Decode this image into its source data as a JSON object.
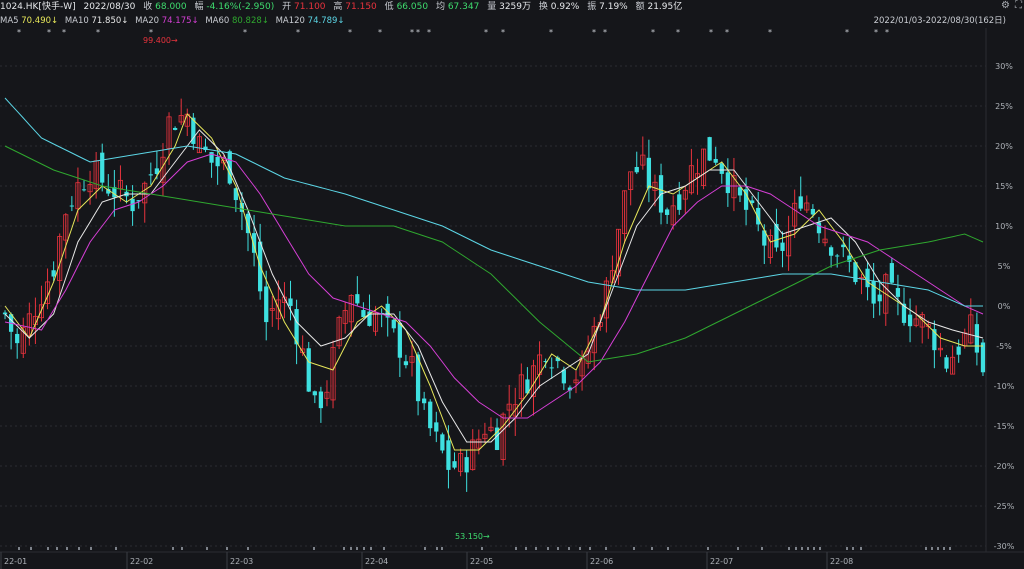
{
  "header": {
    "code": "1024.HK[快手-W]",
    "date": "2022/08/30",
    "close_label": "收",
    "close_value": "68.000",
    "change_label": "幅",
    "change_value": "-4.16%(-2.950)",
    "open_label": "开",
    "open_value": "71.100",
    "high_label": "高",
    "high_value": "71.150",
    "low_label": "低",
    "low_value": "66.050",
    "avg_label": "均",
    "avg_value": "67.347",
    "volume_label": "量",
    "volume_value": "3259万",
    "turnover_label": "换",
    "turnover_value": "0.92%",
    "amplitude_label": "振",
    "amplitude_value": "7.19%",
    "amount_label": "额",
    "amount_value": "21.95亿"
  },
  "ma_bar": {
    "ma5_label": "MA5",
    "ma5_value": "70.490↓",
    "ma10_label": "MA10",
    "ma10_value": "71.850↓",
    "ma20_label": "MA20",
    "ma20_value": "74.175↓",
    "ma60_label": "MA60",
    "ma60_value": "80.828↓",
    "ma120_label": "MA120",
    "ma120_value": "74.789↓"
  },
  "date_range": "2022/01/03-2022/08/30(162日)",
  "colors": {
    "up": "#e8333d",
    "down": "#3ee0e0",
    "ma5": "#e7e75a",
    "ma10": "#e8e8e8",
    "ma20": "#d63fd6",
    "ma60": "#2fa72f",
    "ma120": "#5cd6e6",
    "background": "#15161a"
  },
  "chart_data": {
    "type": "candlestick",
    "axis": {
      "x_tick_labels": [
        "22-01",
        "22-02",
        "22-03",
        "22-04",
        "22-05",
        "22-06",
        "22-07",
        "22-08"
      ],
      "y_tick_labels": [
        "30%",
        "25%",
        "20%",
        "15%",
        "10%",
        "5%",
        "0%",
        "-5%",
        "-10%",
        "-15%",
        "-20%",
        "-25%",
        "-30%"
      ],
      "y_pct_range": [
        -30,
        30
      ]
    },
    "base_price": 70.95,
    "annotations": {
      "high_label": "99.400",
      "low_label": "53.150"
    },
    "price_path_pct": [
      [
        0,
        -1
      ],
      [
        2,
        -5
      ],
      [
        5,
        0
      ],
      [
        8,
        5
      ],
      [
        10,
        12
      ],
      [
        12,
        15
      ],
      [
        14,
        17
      ],
      [
        17,
        15
      ],
      [
        19,
        14
      ],
      [
        21,
        13
      ],
      [
        23,
        15
      ],
      [
        25,
        18
      ],
      [
        27,
        23
      ],
      [
        30,
        24
      ],
      [
        32,
        20
      ],
      [
        34,
        18
      ],
      [
        37,
        17
      ],
      [
        39,
        12
      ],
      [
        41,
        6
      ],
      [
        43,
        -2
      ],
      [
        45,
        1
      ],
      [
        47,
        0
      ],
      [
        49,
        -6
      ],
      [
        51,
        -13
      ],
      [
        53,
        -10
      ],
      [
        55,
        -3
      ],
      [
        57,
        2
      ],
      [
        59,
        -1
      ],
      [
        61,
        -1
      ],
      [
        63,
        -3
      ],
      [
        65,
        -5
      ],
      [
        67,
        -8
      ],
      [
        69,
        -14
      ],
      [
        71,
        -17
      ],
      [
        73,
        -20
      ],
      [
        75,
        -20
      ],
      [
        77,
        -18
      ],
      [
        79,
        -15
      ],
      [
        81,
        -16
      ],
      [
        83,
        -12
      ],
      [
        85,
        -10
      ],
      [
        87,
        -8
      ],
      [
        89,
        -5
      ],
      [
        91,
        -7
      ],
      [
        93,
        -9
      ],
      [
        95,
        -8
      ],
      [
        97,
        -3
      ],
      [
        99,
        2
      ],
      [
        101,
        10
      ],
      [
        103,
        17
      ],
      [
        105,
        17
      ],
      [
        107,
        14
      ],
      [
        109,
        12
      ],
      [
        111,
        14
      ],
      [
        113,
        17
      ],
      [
        115,
        19
      ],
      [
        117,
        19
      ],
      [
        119,
        16
      ],
      [
        121,
        13
      ],
      [
        123,
        11
      ],
      [
        125,
        8
      ],
      [
        127,
        6
      ],
      [
        129,
        9
      ],
      [
        131,
        14
      ],
      [
        133,
        12
      ],
      [
        135,
        9
      ],
      [
        137,
        7
      ],
      [
        139,
        5
      ],
      [
        141,
        3
      ],
      [
        143,
        0
      ],
      [
        145,
        2
      ],
      [
        147,
        0
      ],
      [
        149,
        -1
      ],
      [
        151,
        -2
      ],
      [
        153,
        -4
      ],
      [
        155,
        -7
      ],
      [
        157,
        -5
      ],
      [
        159,
        -3
      ],
      [
        161,
        -8
      ]
    ],
    "ma_paths_pct": {
      "MA5": [
        [
          0,
          0
        ],
        [
          4,
          -4
        ],
        [
          8,
          3
        ],
        [
          12,
          12
        ],
        [
          16,
          15
        ],
        [
          20,
          13
        ],
        [
          24,
          15
        ],
        [
          28,
          20
        ],
        [
          30,
          24
        ],
        [
          34,
          21
        ],
        [
          38,
          15
        ],
        [
          42,
          5
        ],
        [
          46,
          -2
        ],
        [
          50,
          -7
        ],
        [
          54,
          -8
        ],
        [
          58,
          -2
        ],
        [
          62,
          0
        ],
        [
          66,
          -3
        ],
        [
          70,
          -10
        ],
        [
          74,
          -18
        ],
        [
          78,
          -18
        ],
        [
          82,
          -15
        ],
        [
          86,
          -11
        ],
        [
          90,
          -6
        ],
        [
          94,
          -8
        ],
        [
          98,
          -2
        ],
        [
          102,
          8
        ],
        [
          106,
          15
        ],
        [
          110,
          14
        ],
        [
          114,
          16
        ],
        [
          118,
          18
        ],
        [
          122,
          14
        ],
        [
          126,
          8
        ],
        [
          130,
          9
        ],
        [
          134,
          12
        ],
        [
          138,
          8
        ],
        [
          142,
          3
        ],
        [
          146,
          1
        ],
        [
          150,
          -1
        ],
        [
          154,
          -4
        ],
        [
          158,
          -5
        ],
        [
          161,
          -5
        ]
      ],
      "MA10": [
        [
          0,
          -1
        ],
        [
          4,
          -4
        ],
        [
          8,
          -1
        ],
        [
          12,
          8
        ],
        [
          16,
          13
        ],
        [
          20,
          14
        ],
        [
          24,
          14
        ],
        [
          28,
          18
        ],
        [
          32,
          22
        ],
        [
          36,
          19
        ],
        [
          40,
          12
        ],
        [
          44,
          4
        ],
        [
          48,
          -2
        ],
        [
          52,
          -5
        ],
        [
          56,
          -4
        ],
        [
          60,
          -1
        ],
        [
          64,
          -1
        ],
        [
          68,
          -5
        ],
        [
          72,
          -12
        ],
        [
          76,
          -17
        ],
        [
          80,
          -17
        ],
        [
          84,
          -14
        ],
        [
          88,
          -10
        ],
        [
          92,
          -8
        ],
        [
          96,
          -6
        ],
        [
          100,
          2
        ],
        [
          104,
          10
        ],
        [
          108,
          14
        ],
        [
          112,
          15
        ],
        [
          116,
          17
        ],
        [
          120,
          17
        ],
        [
          124,
          13
        ],
        [
          128,
          9
        ],
        [
          132,
          10
        ],
        [
          136,
          11
        ],
        [
          140,
          8
        ],
        [
          144,
          3
        ],
        [
          148,
          0
        ],
        [
          152,
          -2
        ],
        [
          156,
          -3
        ],
        [
          161,
          -4
        ]
      ],
      "MA20": [
        [
          0,
          -2
        ],
        [
          6,
          -3
        ],
        [
          10,
          2
        ],
        [
          14,
          8
        ],
        [
          18,
          12
        ],
        [
          22,
          13
        ],
        [
          26,
          15
        ],
        [
          30,
          18
        ],
        [
          34,
          19
        ],
        [
          38,
          18
        ],
        [
          42,
          14
        ],
        [
          46,
          9
        ],
        [
          50,
          4
        ],
        [
          54,
          1
        ],
        [
          58,
          0
        ],
        [
          62,
          -1
        ],
        [
          66,
          -2
        ],
        [
          70,
          -5
        ],
        [
          74,
          -9
        ],
        [
          78,
          -12
        ],
        [
          82,
          -14
        ],
        [
          86,
          -14
        ],
        [
          90,
          -12
        ],
        [
          94,
          -10
        ],
        [
          98,
          -7
        ],
        [
          102,
          -2
        ],
        [
          106,
          4
        ],
        [
          110,
          10
        ],
        [
          114,
          13
        ],
        [
          118,
          15
        ],
        [
          122,
          15
        ],
        [
          126,
          14
        ],
        [
          130,
          12
        ],
        [
          134,
          10
        ],
        [
          138,
          9
        ],
        [
          142,
          8
        ],
        [
          146,
          6
        ],
        [
          150,
          4
        ],
        [
          154,
          2
        ],
        [
          158,
          0
        ],
        [
          161,
          -1
        ]
      ],
      "MA60": [
        [
          0,
          20
        ],
        [
          8,
          17
        ],
        [
          16,
          15
        ],
        [
          24,
          14
        ],
        [
          32,
          13
        ],
        [
          40,
          12
        ],
        [
          48,
          11
        ],
        [
          56,
          10
        ],
        [
          64,
          10
        ],
        [
          72,
          8
        ],
        [
          80,
          4
        ],
        [
          88,
          -2
        ],
        [
          96,
          -7
        ],
        [
          104,
          -6
        ],
        [
          112,
          -4
        ],
        [
          120,
          -1
        ],
        [
          128,
          2
        ],
        [
          136,
          5
        ],
        [
          144,
          7
        ],
        [
          152,
          8
        ],
        [
          158,
          9
        ],
        [
          161,
          8
        ]
      ],
      "MA120": [
        [
          0,
          26
        ],
        [
          6,
          21
        ],
        [
          14,
          18
        ],
        [
          22,
          19
        ],
        [
          30,
          20
        ],
        [
          38,
          19
        ],
        [
          46,
          16
        ],
        [
          56,
          14
        ],
        [
          64,
          12
        ],
        [
          72,
          10
        ],
        [
          80,
          7
        ],
        [
          88,
          5
        ],
        [
          96,
          3
        ],
        [
          104,
          2
        ],
        [
          112,
          2
        ],
        [
          120,
          3
        ],
        [
          128,
          4
        ],
        [
          136,
          4
        ],
        [
          144,
          3
        ],
        [
          152,
          2
        ],
        [
          158,
          0
        ],
        [
          161,
          0
        ]
      ]
    },
    "volume_markers": "sparse row of small markers at the bottom of the chart"
  }
}
